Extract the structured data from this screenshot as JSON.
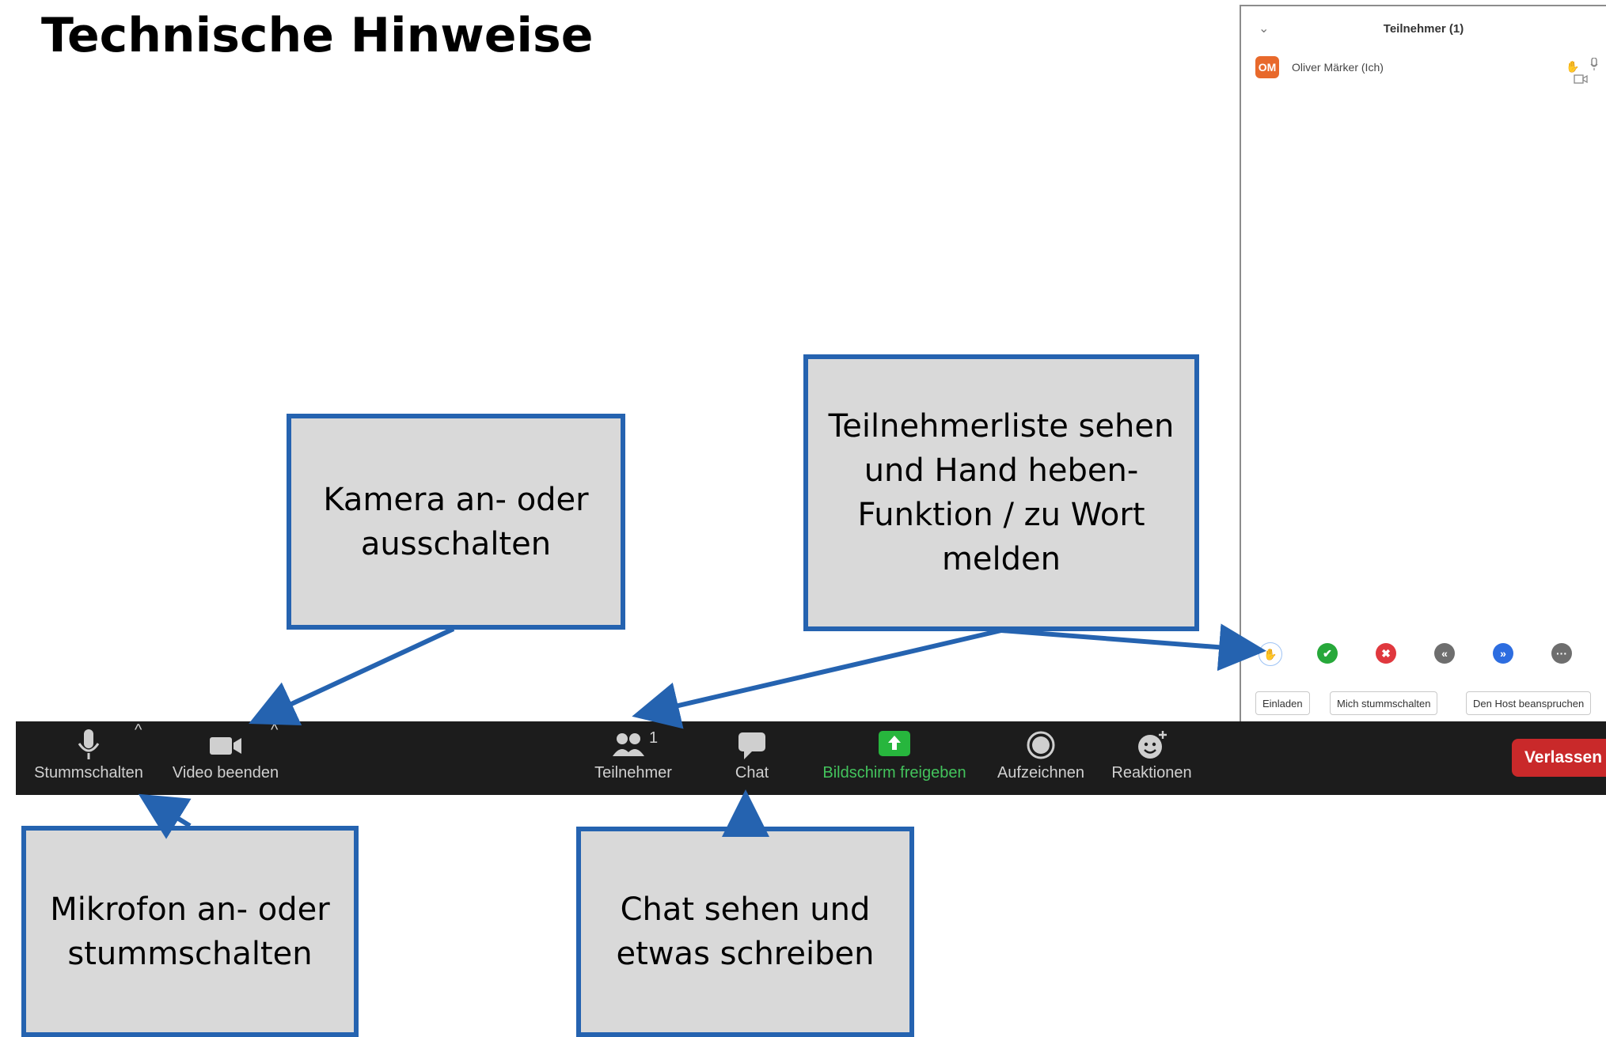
{
  "slide": {
    "title": "Technische Hinweise"
  },
  "participants_panel": {
    "collapse_icon": "chevron-down-icon",
    "title": "Teilnehmer (1)",
    "participant": {
      "initials": "OM",
      "name": "Oliver Märker (Ich)",
      "icons": [
        "hand-icon",
        "microphone-icon",
        "camera-icon"
      ]
    },
    "reactions": [
      {
        "name": "raise-hand",
        "glyph": "✋"
      },
      {
        "name": "yes",
        "glyph": "✔"
      },
      {
        "name": "no",
        "glyph": "✖"
      },
      {
        "name": "go-slower",
        "glyph": "«"
      },
      {
        "name": "go-faster",
        "glyph": "»"
      },
      {
        "name": "more",
        "glyph": "···"
      }
    ],
    "buttons": {
      "invite": "Einladen",
      "mute_me": "Mich stummschalten",
      "claim_host": "Den Host beanspruchen"
    }
  },
  "toolbar": {
    "mute": "Stummschalten",
    "video": "Video beenden",
    "participants": "Teilnehmer",
    "participants_count": "1",
    "chat": "Chat",
    "share": "Bildschirm freigeben",
    "record": "Aufzeichnen",
    "reactions": "Reaktionen",
    "leave": "Verlassen",
    "caret": "^",
    "colors": {
      "background": "#1c1c1c",
      "share_green": "#43c35c",
      "leave_red": "#c9292a"
    }
  },
  "callouts": {
    "camera": "Kamera an- oder\nausschalten",
    "participants": "Teilnehmerliste sehen\nund Hand heben-\nFunktion / zu Wort\nmelden",
    "microphone": "Mikrofon an- oder\nstummschalten",
    "chat": "Chat sehen und\netwas schreiben",
    "border_color": "#2563b0",
    "fill_color": "#d9d9d9"
  }
}
